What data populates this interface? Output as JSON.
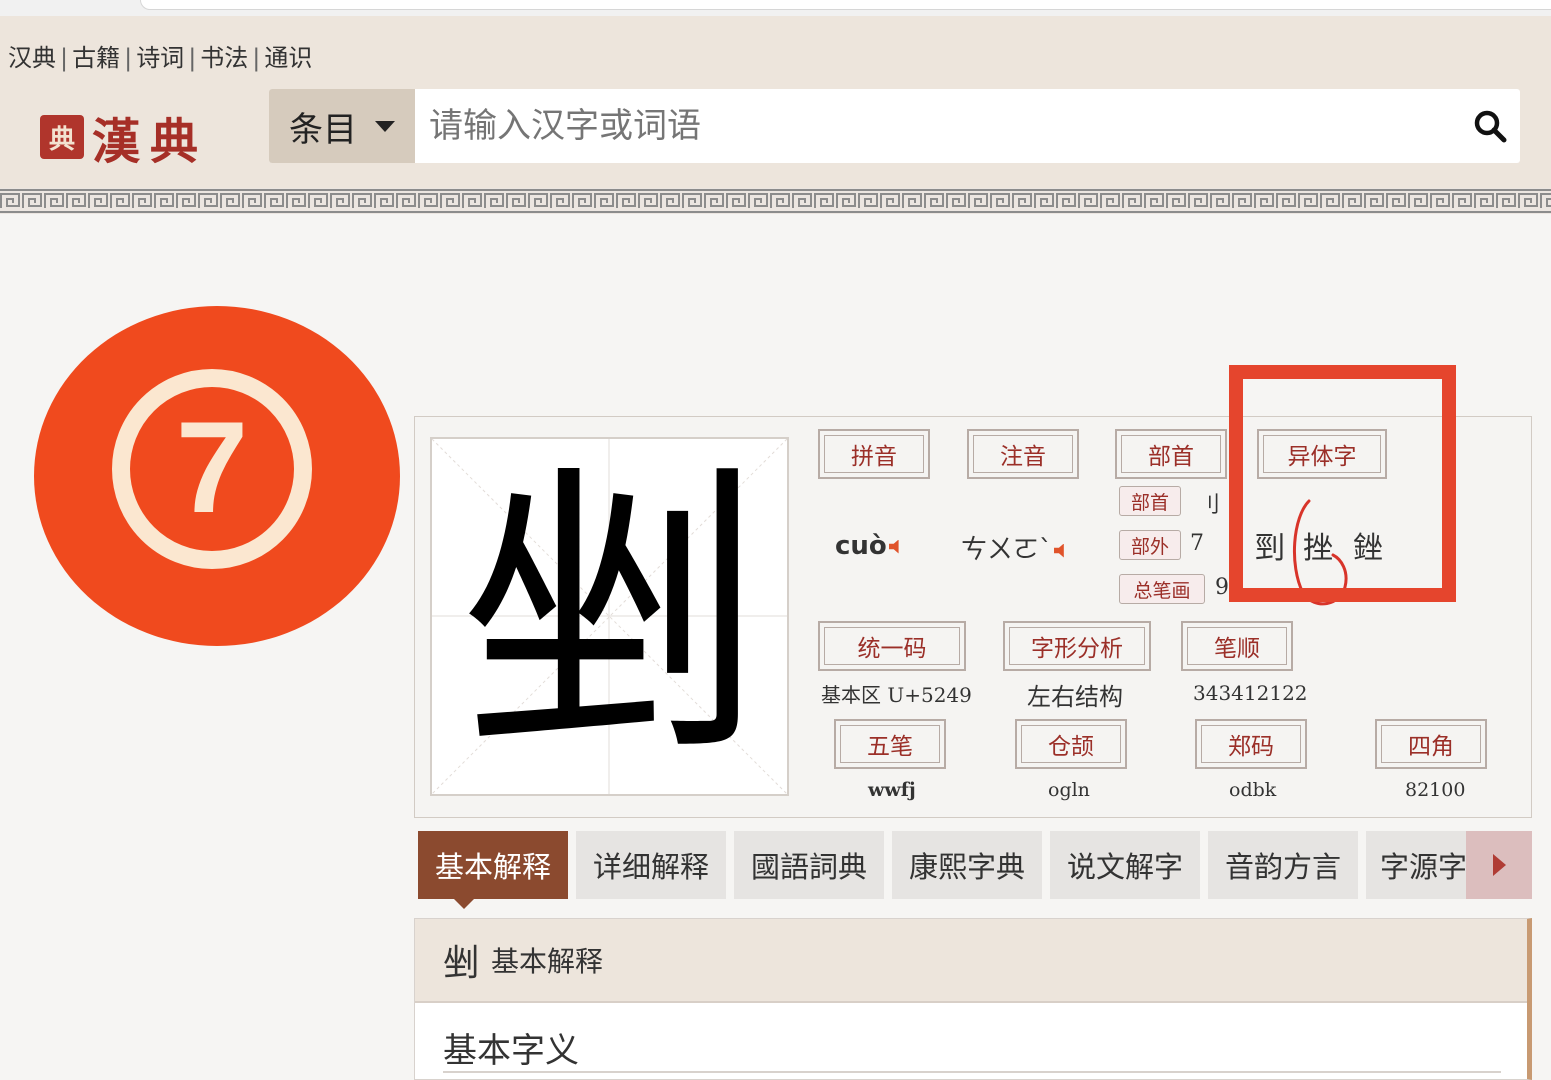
{
  "header": {
    "links": [
      "汉典",
      "古籍",
      "诗词",
      "书法",
      "通识"
    ],
    "separator": "|",
    "logo_seal": "典",
    "logo_text": "漢典",
    "search": {
      "category": "条目",
      "placeholder": "请输入汉字或词语"
    }
  },
  "badge": {
    "label": "7"
  },
  "character": {
    "glyph": "剉",
    "pinyin_label": "拼音",
    "pinyin": "cuò",
    "zhuyin_label": "注音",
    "zhuyin": "ㄘㄨㄛˋ",
    "radical_label": "部首",
    "radical_tag": "部首",
    "radical": "刂",
    "extra_strokes_label": "部外",
    "extra_strokes": "7",
    "total_strokes_label": "总笔画",
    "total_strokes": "9",
    "variants_label": "异体字",
    "variants": [
      "剄",
      "挫",
      "銼"
    ],
    "unicode_label": "统一码",
    "unicode": "基本区  U+5249",
    "structure_label": "字形分析",
    "structure": "左右结构",
    "stroke_order_label": "笔顺",
    "stroke_order": "343412122",
    "wubi_label": "五笔",
    "wubi": "wwfj",
    "cangjie_label": "仓颉",
    "cangjie": "ogln",
    "zhengma_label": "郑码",
    "zhengma": "odbk",
    "sijiao_label": "四角",
    "sijiao": "82100"
  },
  "tabs": [
    "基本解释",
    "详细解释",
    "國語詞典",
    "康熙字典",
    "说文解字",
    "音韵方言",
    "字源字"
  ],
  "content": {
    "header_char": "剉",
    "header_title": "基本解释",
    "subheading": "基本字义"
  },
  "colors": {
    "accent": "#8b4a2f",
    "brand_red": "#a62f27",
    "badge": "#f04a1e",
    "highlight_box": "#e5452d"
  }
}
